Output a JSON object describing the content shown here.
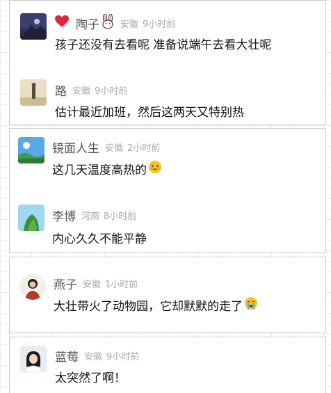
{
  "comments_section": {
    "cards": [
      {
        "comments": [
          {
            "name": "陶子",
            "location": "安徽",
            "time": "9小时前",
            "text": "孩子还没有去看呢 准备说端午去看大壮呢",
            "name_prefix_icon": "heart-icon",
            "name_suffix_icon": "bunny-icon"
          },
          {
            "name": "路",
            "location": "安徽",
            "time": "9小时前",
            "text": "估计最近加班，然后这两天又特别热"
          }
        ]
      },
      {
        "comments": [
          {
            "name": "镜面人生",
            "location": "安徽",
            "time": "2小时前",
            "text": "这几天温度高热的",
            "text_suffix_icon": "hot-face-emoji"
          },
          {
            "name": "李博",
            "location": "河南",
            "time": "8小时前",
            "text": "内心久久不能平静"
          }
        ]
      },
      {
        "comments": [
          {
            "name": "燕子",
            "location": "安徽",
            "time": "1小时前",
            "text": "大壮带火了动物园，它却默默的走了",
            "text_suffix_icon": "crying-face-emoji"
          }
        ]
      },
      {
        "comments": [
          {
            "name": "蓝莓",
            "location": "安徽",
            "time": "9小时前",
            "text": "太突然了啊！"
          }
        ]
      }
    ]
  },
  "colors": {
    "card_border": "#c9c9c9",
    "name": "#555555",
    "meta": "#a8a8a8",
    "text": "#111111",
    "heart": "#e0243b",
    "emoji": "#f6c324"
  }
}
